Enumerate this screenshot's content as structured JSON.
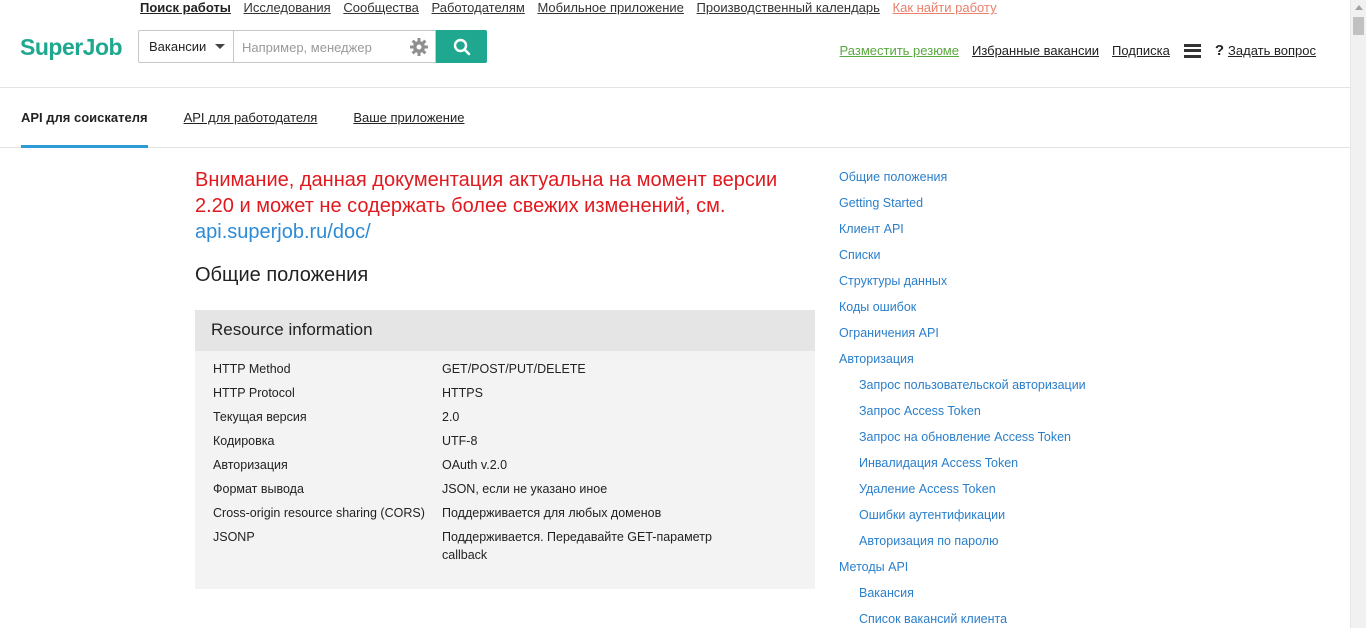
{
  "top_links": [
    "Поиск работы",
    "Исследования",
    "Сообщества",
    "Работодателям",
    "Мобильное приложение",
    "Производственный календарь",
    "Как найти работу"
  ],
  "logo": "SuperJob",
  "search": {
    "category": "Вакансии",
    "placeholder": "Например, менеджер"
  },
  "header_links": {
    "post_resume": "Разместить резюме",
    "favorites": "Избранные вакансии",
    "subscription": "Подписка",
    "ask": "Задать вопрос"
  },
  "tabs": [
    "API для соискателя",
    "API для работодателя",
    "Ваше приложение"
  ],
  "warning": {
    "text": "Внимание, данная документация актуальна на момент версии 2.20 и может не содержать более свежих изменений, см. ",
    "link": "api.superjob.ru/doc/"
  },
  "section_title": "Общие положения",
  "resource": {
    "title": "Resource information",
    "rows": [
      {
        "k": "HTTP Method",
        "v": "GET/POST/PUT/DELETE"
      },
      {
        "k": "HTTP Protocol",
        "v": "HTTPS"
      },
      {
        "k": "Текущая версия",
        "v": "2.0"
      },
      {
        "k": "Кодировка",
        "v": "UTF-8"
      },
      {
        "k": "Авторизация",
        "v": "OAuth v.2.0"
      },
      {
        "k": "Формат вывода",
        "v": "JSON, если не указано иное"
      },
      {
        "k": "Cross-origin resource sharing (CORS)",
        "v": "Поддерживается для любых доменов"
      },
      {
        "k": "JSONP",
        "v": "Поддерживается. Передавайте GET-параметр callback"
      }
    ]
  },
  "sidebar": [
    {
      "label": "Общие положения",
      "sub": false
    },
    {
      "label": "Getting Started",
      "sub": false
    },
    {
      "label": "Клиент API",
      "sub": false
    },
    {
      "label": "Списки",
      "sub": false
    },
    {
      "label": "Структуры данных",
      "sub": false
    },
    {
      "label": "Коды ошибок",
      "sub": false
    },
    {
      "label": "Ограничения API",
      "sub": false
    },
    {
      "label": "Авторизация",
      "sub": false
    },
    {
      "label": "Запрос пользовательской авторизации",
      "sub": true
    },
    {
      "label": "Запрос Access Token",
      "sub": true
    },
    {
      "label": "Запрос на обновление Access Token",
      "sub": true
    },
    {
      "label": "Инвалидация Access Token",
      "sub": true
    },
    {
      "label": "Удаление Access Token",
      "sub": true
    },
    {
      "label": "Ошибки аутентификации",
      "sub": true
    },
    {
      "label": "Авторизация по паролю",
      "sub": true
    },
    {
      "label": "Методы API",
      "sub": false
    },
    {
      "label": "Вакансия",
      "sub": true
    },
    {
      "label": "Список вакансий клиента",
      "sub": true
    }
  ],
  "colors": {
    "brand": "#1fa88f",
    "warning": "#e0191e",
    "link": "#2a7fcc",
    "tab_underline": "#2f9bd6"
  }
}
